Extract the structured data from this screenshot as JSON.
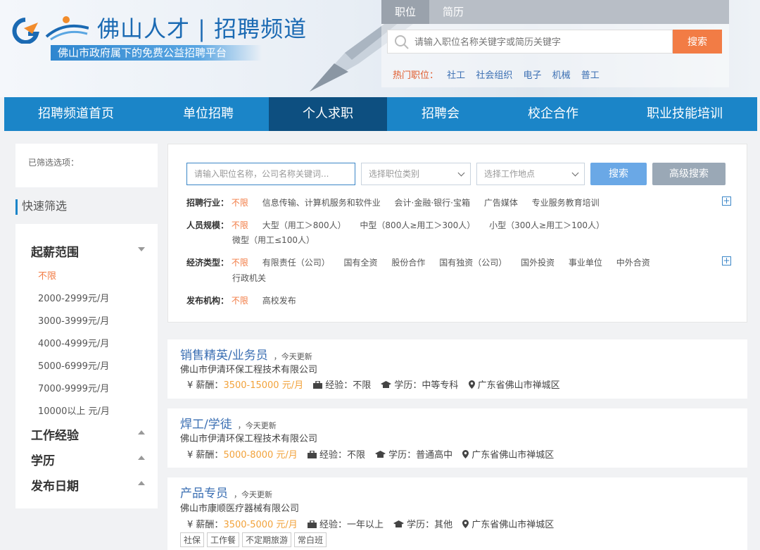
{
  "header": {
    "logo_title": "佛山人才 | 招聘频道",
    "logo_subtitle": "佛山市政府属下的免费公益招聘平台",
    "search": {
      "tabs": [
        "职位",
        "简历"
      ],
      "active_tab": 0,
      "placeholder": "请输入职位名称关键字或简历关键字",
      "button": "搜索"
    },
    "hot": {
      "label": "热门职位：",
      "links": [
        "社工",
        "社会组织",
        "电子",
        "机械",
        "普工"
      ]
    }
  },
  "nav": {
    "items": [
      "招聘频道首页",
      "单位招聘",
      "个人求职",
      "招聘会",
      "校企合作",
      "职业技能培训"
    ],
    "active": 2
  },
  "sidebar": {
    "selected_label": "已筛选选项：",
    "quick_title": "快速筛选",
    "salary_title": "起薪范围",
    "salary_items": [
      "不限",
      "2000-2999元/月",
      "3000-3999元/月",
      "4000-4999元/月",
      "5000-6999元/月",
      "7000-9999元/月",
      "10000以上 元/月"
    ],
    "groups": [
      "工作经验",
      "学历",
      "发布日期"
    ]
  },
  "filter": {
    "keyword_placeholder": "请输入职位名称，公司名称关键词...",
    "category_placeholder": "选择职位类别",
    "location_placeholder": "选择工作地点",
    "search_button": "搜索",
    "advanced_button": "高级搜索",
    "industry": {
      "label": "招聘行业：",
      "options": [
        "不限",
        "信息传输、计算机服务和软件业",
        "会计·金融·银行·宝箱",
        "广告媒体",
        "专业服务教育培训"
      ]
    },
    "size": {
      "label": "人员规模：",
      "options": [
        "不限",
        "大型（用工＞800人）",
        "中型（800人≥用工＞300人）",
        "小型（300人≥用工＞100人）"
      ],
      "options_line2": [
        "微型（用工≤100人）"
      ]
    },
    "economy": {
      "label": "经济类型：",
      "options": [
        "不限",
        "有限责任（公司）",
        "国有全资",
        "股份合作",
        "国有独资（公司）",
        "国外投资",
        "事业单位",
        "中外合资"
      ],
      "options_line2": [
        "行政机关"
      ]
    },
    "publisher": {
      "label": "发布机构：",
      "options": [
        "不限",
        "高校发布"
      ]
    },
    "plus_symbol": "+"
  },
  "jobs": [
    {
      "title": "销售精英/业务员",
      "updated": "，今天更新",
      "company": "佛山市伊清环保工程技术有限公司",
      "salary_label": "薪酬：",
      "salary": "3500-15000 元/月",
      "exp_label": "经验：",
      "exp": "不限",
      "edu_label": "学历：",
      "edu": "中等专科",
      "location": "广东省佛山市禅城区",
      "tags": []
    },
    {
      "title": "焊工/学徒",
      "updated": "，今天更新",
      "company": "佛山市伊清环保工程技术有限公司",
      "salary_label": "薪酬：",
      "salary": "5000-8000 元/月",
      "exp_label": "经验：",
      "exp": "不限",
      "edu_label": "学历：",
      "edu": "普通高中",
      "location": "广东省佛山市禅城区",
      "tags": []
    },
    {
      "title": "产品专员",
      "updated": "，今天更新",
      "company": "佛山市康顺医疗器械有限公司",
      "salary_label": "薪酬：",
      "salary": "3500-5000 元/月",
      "exp_label": "经验：",
      "exp": "一年以上",
      "edu_label": "学历：",
      "edu": "其他",
      "location": "广东省佛山市禅城区",
      "tags": [
        "社保",
        "工作餐",
        "不定期旅游",
        "常白班"
      ]
    }
  ],
  "currency_symbol": "¥"
}
